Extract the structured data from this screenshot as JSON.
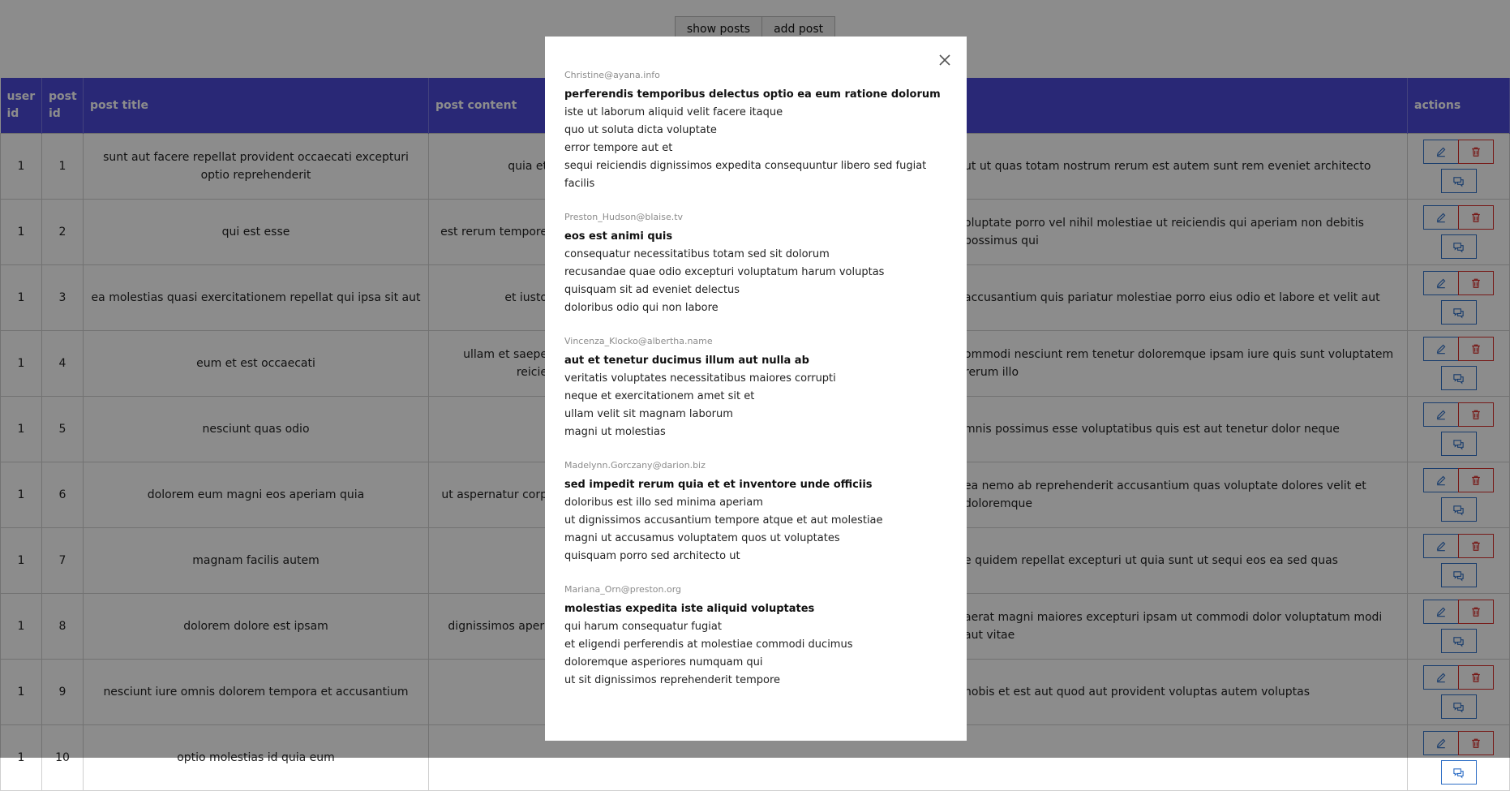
{
  "topbar": {
    "show_label": "show posts",
    "add_label": "add post"
  },
  "table": {
    "headers": {
      "user_id": "user id",
      "post_id": "post id",
      "post_title": "post title",
      "post_content": "post content",
      "actions": "actions"
    },
    "rows": [
      {
        "user_id": "1",
        "post_id": "1",
        "title": "sunt aut facere repellat provident occaecati excepturi optio reprehenderit",
        "content_left": "quia et",
        "content_right": "ut ut quas totam nostrum rerum est autem sunt rem eveniet architecto"
      },
      {
        "user_id": "1",
        "post_id": "2",
        "title": "qui est esse",
        "content_left": "est rerum tempore",
        "content_right": "oluptate porro vel nihil molestiae ut reiciendis qui aperiam non debitis possimus qui"
      },
      {
        "user_id": "1",
        "post_id": "3",
        "title": "ea molestias quasi exercitationem repellat qui ipsa sit aut",
        "content_left": "et iusto",
        "content_right": "accusantium quis pariatur molestiae porro eius odio et labore et velit aut"
      },
      {
        "user_id": "1",
        "post_id": "4",
        "title": "eum et est occaecati",
        "content_left": "ullam et saepe reicie",
        "content_right": "ommodi nesciunt rem tenetur doloremque ipsam iure quis sunt voluptatem rerum illo"
      },
      {
        "user_id": "1",
        "post_id": "5",
        "title": "nesciunt quas odio",
        "content_left": "",
        "content_right": "mnis possimus esse voluptatibus quis est aut tenetur dolor neque"
      },
      {
        "user_id": "1",
        "post_id": "6",
        "title": "dolorem eum magni eos aperiam quia",
        "content_left": "ut aspernatur corp",
        "content_right": "ea nemo ab reprehenderit accusantium quas voluptate dolores velit et doloremque"
      },
      {
        "user_id": "1",
        "post_id": "7",
        "title": "magnam facilis autem",
        "content_left": "",
        "content_right": "e quidem repellat excepturi ut quia sunt ut sequi eos ea sed quas"
      },
      {
        "user_id": "1",
        "post_id": "8",
        "title": "dolorem dolore est ipsam",
        "content_left": "dignissimos aperi",
        "content_right": "aerat magni maiores excepturi ipsam ut commodi dolor voluptatum modi aut vitae"
      },
      {
        "user_id": "1",
        "post_id": "9",
        "title": "nesciunt iure omnis dolorem tempora et accusantium",
        "content_left": "",
        "content_right": "nobis et est aut quod aut provident voluptas autem voluptas"
      },
      {
        "user_id": "1",
        "post_id": "10",
        "title": "optio molestias id quia eum",
        "content_left": "",
        "content_right": ""
      }
    ]
  },
  "modal": {
    "comments": [
      {
        "email": "Christine@ayana.info",
        "name": "perferendis temporibus delectus optio ea eum ratione dolorum",
        "body": [
          "iste ut laborum aliquid velit facere itaque",
          "quo ut soluta dicta voluptate",
          "error tempore aut et",
          "sequi reiciendis dignissimos expedita consequuntur libero sed fugiat facilis"
        ]
      },
      {
        "email": "Preston_Hudson@blaise.tv",
        "name": "eos est animi quis",
        "body": [
          "consequatur necessitatibus totam sed sit dolorum",
          "recusandae quae odio excepturi voluptatum harum voluptas",
          "quisquam sit ad eveniet delectus",
          "doloribus odio qui non labore"
        ]
      },
      {
        "email": "Vincenza_Klocko@albertha.name",
        "name": "aut et tenetur ducimus illum aut nulla ab",
        "body": [
          "veritatis voluptates necessitatibus maiores corrupti",
          "neque et exercitationem amet sit et",
          "ullam velit sit magnam laborum",
          "magni ut molestias"
        ]
      },
      {
        "email": "Madelynn.Gorczany@darion.biz",
        "name": "sed impedit rerum quia et et inventore unde officiis",
        "body": [
          "doloribus est illo sed minima aperiam",
          "ut dignissimos accusantium tempore atque et aut molestiae",
          "magni ut accusamus voluptatem quos ut voluptates",
          "quisquam porro sed architecto ut"
        ]
      },
      {
        "email": "Mariana_Orn@preston.org",
        "name": "molestias expedita iste aliquid voluptates",
        "body": [
          "qui harum consequatur fugiat",
          "et eligendi perferendis at molestiae commodi ducimus",
          "doloremque asperiores numquam qui",
          "ut sit dignissimos reprehenderit tempore"
        ]
      }
    ]
  },
  "icons": {
    "edit": "pencil-icon",
    "delete": "trash-icon",
    "comments": "chat-icon",
    "close": "close-icon"
  },
  "colors": {
    "header_bg": "#4b4ad8",
    "edit": "#2f6fc6",
    "delete": "#d9302c",
    "overlay": "rgba(0,0,0,0.45)"
  }
}
